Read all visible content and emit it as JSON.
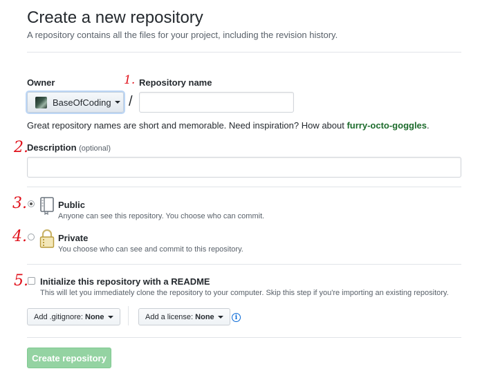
{
  "page": {
    "title": "Create a new repository",
    "subtitle": "A repository contains all the files for your project, including the revision history."
  },
  "annotations": [
    "1.",
    "2.",
    "3.",
    "4.",
    "5."
  ],
  "owner": {
    "label": "Owner",
    "value": "BaseOfCoding"
  },
  "repo_name": {
    "label": "Repository name",
    "value": "",
    "separator": "/"
  },
  "hint": {
    "text": "Great repository names are short and memorable. Need inspiration? How about ",
    "suggestion": "furry-octo-goggles",
    "period": "."
  },
  "description": {
    "label": "Description",
    "optional": "(optional)",
    "value": ""
  },
  "visibility": {
    "selected": "public",
    "public": {
      "label": "Public",
      "desc": "Anyone can see this repository. You choose who can commit."
    },
    "private": {
      "label": "Private",
      "desc": "You choose who can see and commit to this repository."
    }
  },
  "readme": {
    "checked": false,
    "label": "Initialize this repository with a README",
    "desc": "This will let you immediately clone the repository to your computer. Skip this step if you're importing an existing repository."
  },
  "gitignore": {
    "label": "Add .gitignore:",
    "value": "None"
  },
  "license": {
    "label": "Add a license:",
    "value": "None"
  },
  "submit": {
    "label": "Create repository",
    "disabled": true
  },
  "colors": {
    "link_green": "#1c6b2c",
    "annotation_red": "#e0101a",
    "submit_disabled": "#94d3a2",
    "info_blue": "#0366d6"
  },
  "icons": [
    "repo-book-icon",
    "lock-icon",
    "info-icon",
    "caret-down-icon"
  ]
}
